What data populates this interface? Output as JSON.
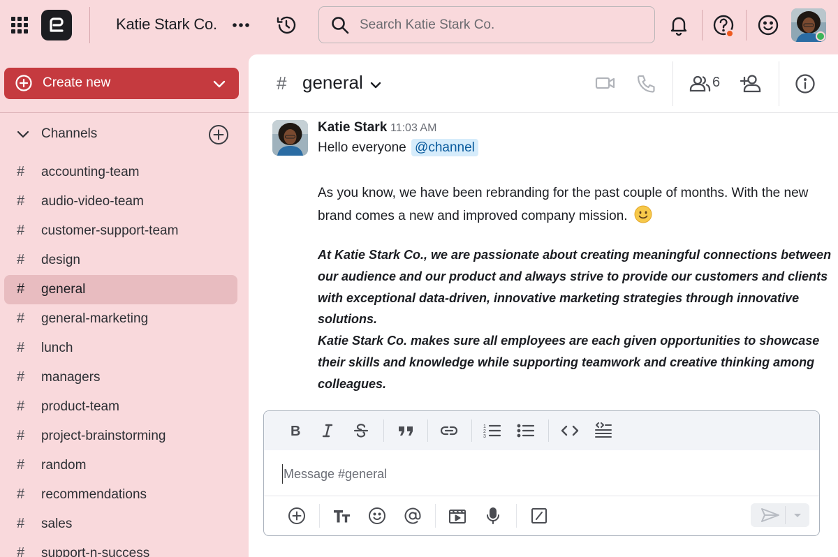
{
  "topbar": {
    "workspace_name": "Katie Stark Co.",
    "search_placeholder": "Search Katie Stark Co.",
    "notification_dot_color": "#ee5a1f",
    "status_color": "#3db55a"
  },
  "sidebar": {
    "create_new_label": "Create new",
    "create_new_color": "#c53a3f",
    "section_label": "Channels",
    "channels": [
      {
        "name": "accounting-team",
        "active": false
      },
      {
        "name": "audio-video-team",
        "active": false
      },
      {
        "name": "customer-support-team",
        "active": false
      },
      {
        "name": "design",
        "active": false
      },
      {
        "name": "general",
        "active": true
      },
      {
        "name": "general-marketing",
        "active": false
      },
      {
        "name": "lunch",
        "active": false
      },
      {
        "name": "managers",
        "active": false
      },
      {
        "name": "product-team",
        "active": false
      },
      {
        "name": "project-brainstorming",
        "active": false
      },
      {
        "name": "random",
        "active": false
      },
      {
        "name": "recommendations",
        "active": false
      },
      {
        "name": "sales",
        "active": false
      },
      {
        "name": "support-n-success",
        "active": false
      }
    ],
    "hash_symbol": "#"
  },
  "room": {
    "hash_symbol": "#",
    "name": "general",
    "members_count": "6"
  },
  "message": {
    "author": "Katie Stark",
    "time": "11:03 AM",
    "greeting": "Hello everyone",
    "mention": "@channel",
    "paragraph": "As you know, we have been rebranding for the past couple of months. With the new brand comes a new and improved company mission.",
    "mission_1": "At Katie Stark Co., we are passionate about creating meaningful connections between our audience and our product and always strive to provide our customers and clients with exceptional data-driven, innovative marketing strategies through innovative solutions.",
    "mission_2": "Katie Stark Co. makes sure all employees are each given opportunities to showcase their skills and knowledge while supporting teamwork and creative thinking among colleagues."
  },
  "composer": {
    "placeholder": "Message #general",
    "format_tools": [
      "bold-icon",
      "italic-icon",
      "strikethrough-icon",
      "quote-icon",
      "link-icon",
      "numbered-list-icon",
      "bullet-list-icon",
      "code-icon",
      "code-block-icon"
    ],
    "action_tools": [
      "add-icon",
      "text-format-icon",
      "emoji-icon",
      "mention-icon",
      "video-message-icon",
      "microphone-icon",
      "slash-command-icon"
    ]
  },
  "colors": {
    "background": "#f9d9dc",
    "active_channel": "#e8bcc0",
    "mention_bg": "#d6ecfb",
    "mention_text": "#095a9d"
  }
}
